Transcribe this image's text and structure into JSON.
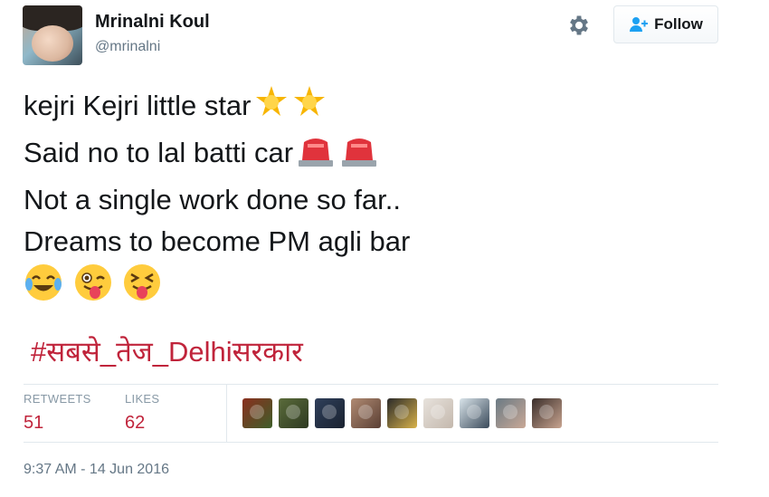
{
  "user": {
    "name": "Mrinalni Koul",
    "handle": "@mrinalni"
  },
  "actions": {
    "follow_label": "Follow"
  },
  "icons": {
    "settings": "gear-icon",
    "follow": "add-user-icon"
  },
  "tweet": {
    "lines": [
      "kejri Kejri little star",
      "Said no to lal batti car",
      "Not a single work done so far..",
      "Dreams to become PM agli bar"
    ],
    "emoji_line1": [
      "glowing-star",
      "glowing-star"
    ],
    "emoji_line2": [
      "police-light",
      "police-light"
    ],
    "emoji_line5": [
      "joy-face",
      "winking-tongue-face",
      "squinting-tongue-face"
    ],
    "hashtag": "#सबसे_तेज_Delhiसरकार"
  },
  "stats": {
    "retweets_label": "RETWEETS",
    "retweets_count": "51",
    "likes_label": "LIKES",
    "likes_count": "62"
  },
  "likers_count_shown": 9,
  "timestamp": "9:37 AM - 14 Jun 2016",
  "colors": {
    "accent": "#c0243b",
    "muted": "#657786",
    "text": "#14171a",
    "border": "#e1e8ed"
  }
}
